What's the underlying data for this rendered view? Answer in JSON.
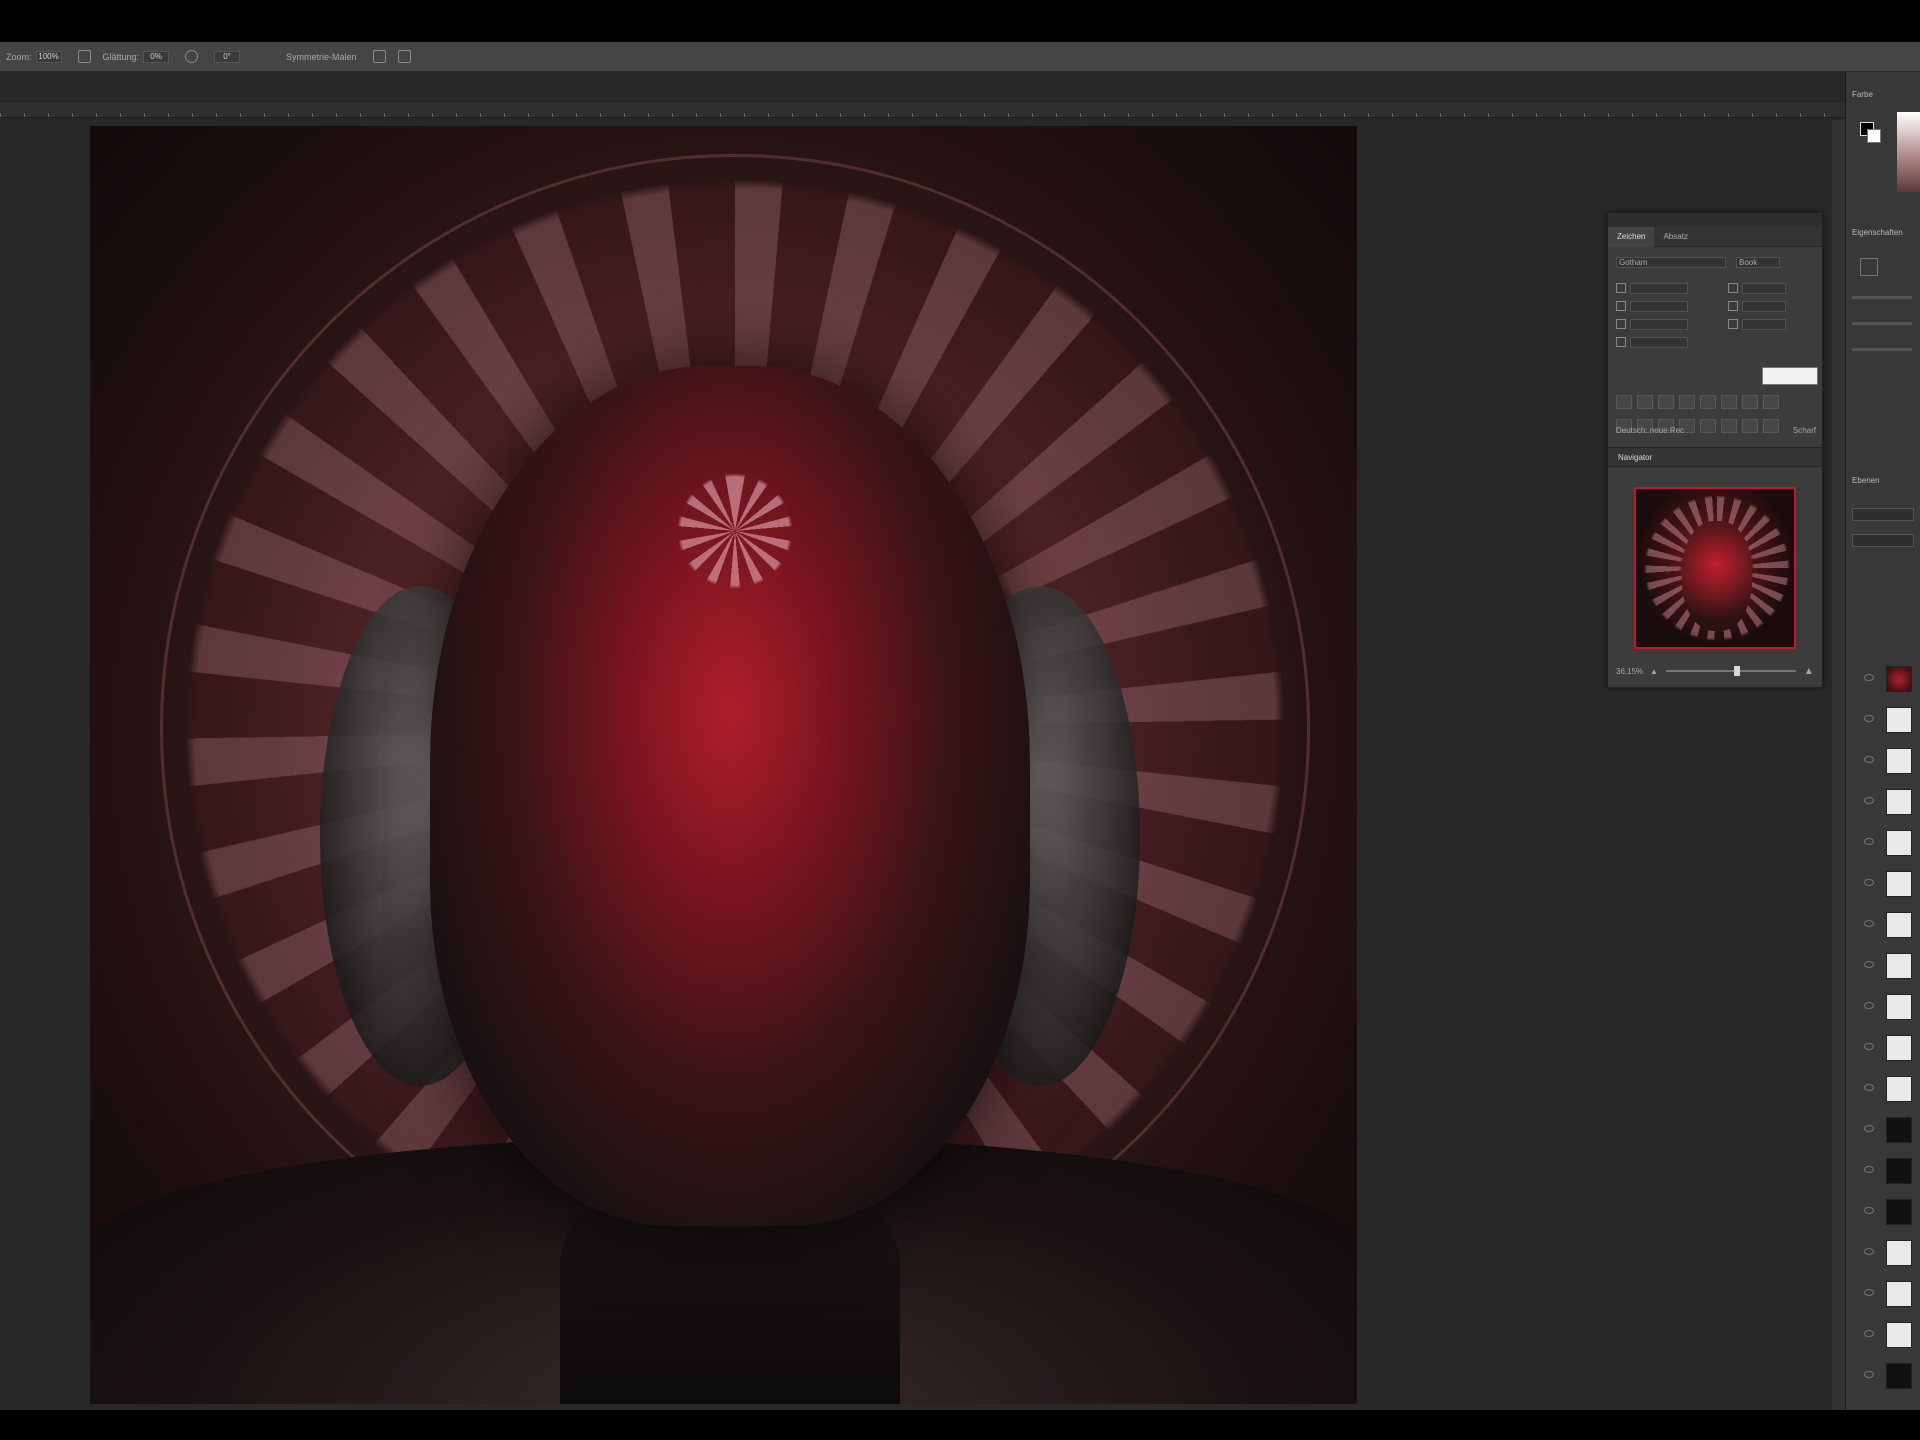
{
  "options_bar": {
    "zoom_label": "Zoom:",
    "zoom_value": "100%",
    "smoothing_label": "Glättung:",
    "smoothing_value": "0%",
    "angle_value": "0°",
    "option_text": "Symmetrie-Malen"
  },
  "right_dock": {
    "tools_header": "Farbe",
    "properties_header": "Eigenschaften",
    "layers_header": "Ebenen",
    "layers": [
      {
        "thumb": "img"
      },
      {
        "thumb": "light"
      },
      {
        "thumb": "light"
      },
      {
        "thumb": "light"
      },
      {
        "thumb": "light"
      },
      {
        "thumb": "light"
      },
      {
        "thumb": "light"
      },
      {
        "thumb": "light"
      },
      {
        "thumb": "light"
      },
      {
        "thumb": "light"
      },
      {
        "thumb": "light"
      },
      {
        "thumb": "dark"
      },
      {
        "thumb": "dark"
      },
      {
        "thumb": "dark"
      },
      {
        "thumb": "light"
      },
      {
        "thumb": "light"
      },
      {
        "thumb": "light"
      },
      {
        "thumb": "dark"
      }
    ]
  },
  "floating_panel": {
    "tabs": [
      "Zeichen",
      "Absatz"
    ],
    "font_family": "Gotham",
    "font_style": "Book",
    "navigator_title": "Navigator",
    "zoom_readout": "36,15%",
    "zoom_slider_fraction": 0.55,
    "language": "Deutsch: neue Rec",
    "antialias": "Scharf"
  },
  "colors": {
    "accent": "#c01a2a",
    "panel_bg": "#3c3c3c",
    "workspace_bg": "#282828"
  }
}
